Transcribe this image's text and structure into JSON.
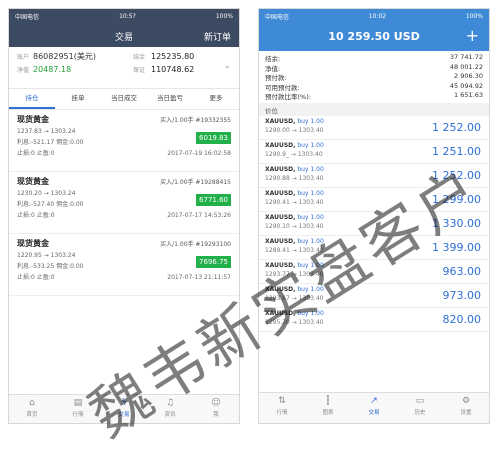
{
  "left": {
    "status": {
      "carrier": "中国电信",
      "time": "10:5?",
      "battery": "100%"
    },
    "nav": {
      "title": "交易",
      "action": "新订单"
    },
    "account": {
      "id_label": "账户",
      "id": "86082951(美元)",
      "bal_label": "结余",
      "balance": "125235.80",
      "eq_label": "净值",
      "equity": "20487.18",
      "margin_label": "保证",
      "margin": "110748.62"
    },
    "tabs": [
      "持仓",
      "挂单",
      "当日成交",
      "当日盈亏",
      "更多"
    ],
    "positions": [
      {
        "name": "现货黄金",
        "side": "买入/1.00手 #19332355",
        "prices": "1237.83 → 1303.24",
        "profit": "利息:-521.17   佣金:0.00",
        "sl": "止损:0       止盈:0",
        "pnl": "6019.83",
        "time": "2017-07-19 16:02:58"
      },
      {
        "name": "现货黄金",
        "side": "买入/1.00手 #19288415",
        "prices": "1230.20 → 1303.24",
        "profit": "利息:-527.40   佣金:0.00",
        "sl": "止损:0       止盈:0",
        "pnl": "6771.60",
        "time": "2017-07-17 14:53:26"
      },
      {
        "name": "现货黄金",
        "side": "买入/1.00手 #19293100",
        "prices": "1220.95 → 1303.24",
        "profit": "利息:-533.25   佣金:0.00",
        "sl": "止损:0       止盈:0",
        "pnl": "7696.75",
        "time": "2017-07-13 21:11:57"
      }
    ],
    "bottom": [
      "首页",
      "行情",
      "交易",
      "资讯",
      "我"
    ]
  },
  "right": {
    "status": {
      "carrier": "中国电信",
      "time": "10:02",
      "battery": "100%"
    },
    "nav": {
      "title": "10 259.50 USD",
      "plus": "+"
    },
    "summary": [
      {
        "k": "结余:",
        "v": "37 741.72"
      },
      {
        "k": "净值:",
        "v": "48 001.22"
      },
      {
        "k": "预付款:",
        "v": "2 906.30"
      },
      {
        "k": "可用预付款:",
        "v": "45 094.92"
      },
      {
        "k": "预付款比率(%):",
        "v": "1 651.63"
      }
    ],
    "section": "价位",
    "trades": [
      {
        "sym": "XAUUSD,",
        "act": "buy 1.00",
        "prices": "1290.00 → 1303.40",
        "value": "1 252.00"
      },
      {
        "sym": "XAUUSD,",
        "act": "buy 1.00",
        "prices": "1290.9_ → 1303.40",
        "value": "1 251.00"
      },
      {
        "sym": "XAUUSD,",
        "act": "buy 1.00",
        "prices": "1290.88 → 1303.40",
        "value": "1 252.00"
      },
      {
        "sym": "XAUUSD,",
        "act": "buy 1.00",
        "prices": "1290.41 → 1303.40",
        "value": "1 299.00"
      },
      {
        "sym": "XAUUSD,",
        "act": "buy 1.00",
        "prices": "1290.10 → 1303.40",
        "value": "1 330.00"
      },
      {
        "sym": "XAUUSD,",
        "act": "buy 1.00",
        "prices": "1289.41 → 1303.40",
        "value": "1 399.00"
      },
      {
        "sym": "XAUUSD,",
        "act": "buy 1.00",
        "prices": "1293.77 → 1303.40",
        "value": "963.00"
      },
      {
        "sym": "XAUUSD,",
        "act": "buy 1.00",
        "prices": "1293.67 → 1303.40",
        "value": "973.00"
      },
      {
        "sym": "XAUUSD,",
        "act": "buy 1.00",
        "prices": "1295.20 → 1303.40",
        "value": "820.00"
      }
    ],
    "bottom": [
      "行情",
      "图表",
      "交易",
      "历史",
      "设置"
    ]
  },
  "watermark": "魏韦新实盘客户"
}
